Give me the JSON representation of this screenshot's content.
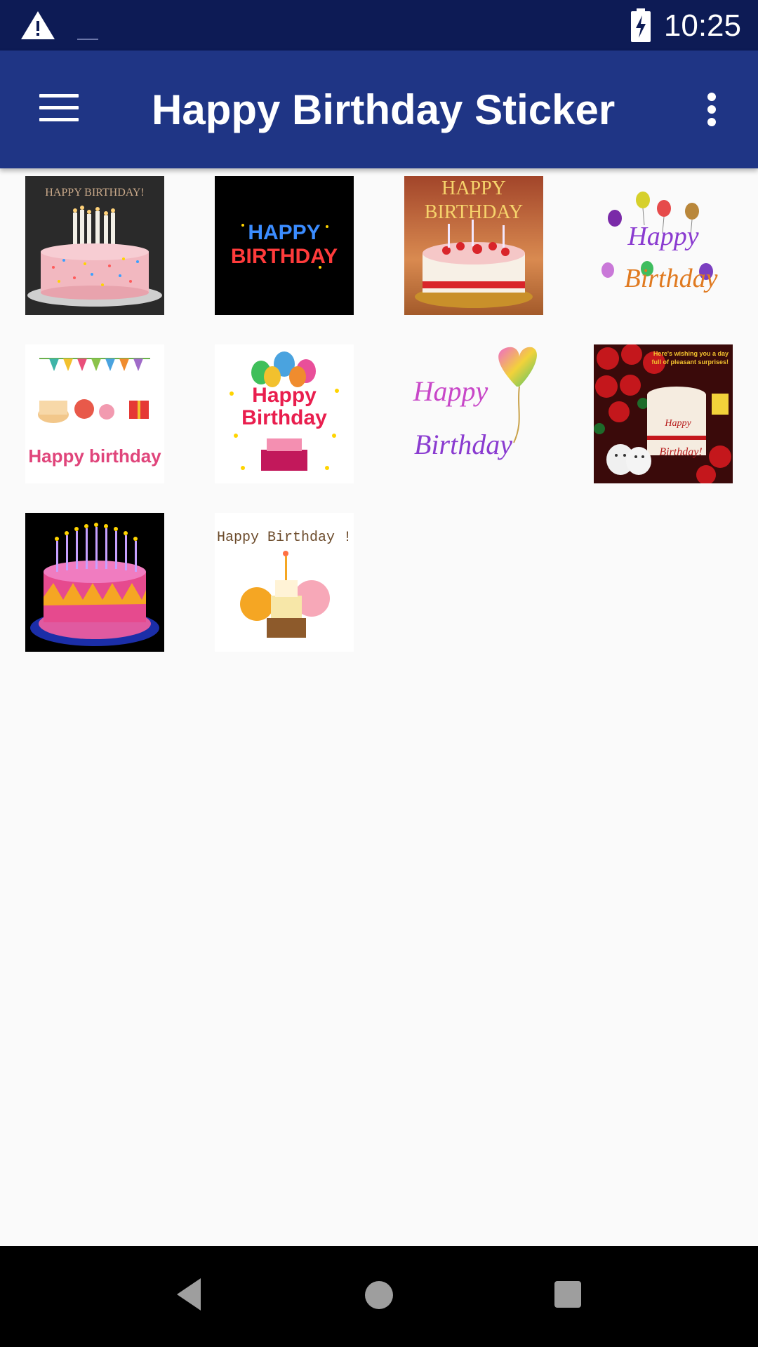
{
  "status_bar": {
    "time": "10:25",
    "icons": [
      "warning-icon",
      "battery-charging-icon"
    ]
  },
  "app_bar": {
    "title": "Happy Birthday Sticker",
    "icons": [
      "menu-icon",
      "more-vert-icon"
    ]
  },
  "stickers": [
    {
      "id": "sticker-1",
      "caption": "HAPPY BIRTHDAY!"
    },
    {
      "id": "sticker-2",
      "caption_line1": "HAPPY",
      "caption_line2": "BIRTHDAY"
    },
    {
      "id": "sticker-3",
      "caption_line1": "HAPPY",
      "caption_line2": "BIRTHDAY"
    },
    {
      "id": "sticker-4",
      "caption_line1": "Happy",
      "caption_line2": "Birthday"
    },
    {
      "id": "sticker-5",
      "caption": "Happy birthday"
    },
    {
      "id": "sticker-6",
      "caption_line1": "Happy",
      "caption_line2": "Birthday"
    },
    {
      "id": "sticker-7",
      "caption_line1": "Happy",
      "caption_line2": "Birthday"
    },
    {
      "id": "sticker-8",
      "caption_line1": "Here's wishing you a day",
      "caption_line2": "full of pleasant surprises!",
      "cake_line1": "Happy",
      "cake_line2": "Birthday!"
    },
    {
      "id": "sticker-9"
    },
    {
      "id": "sticker-10",
      "caption": "Happy Birthday !"
    }
  ],
  "nav_bar": {
    "icons": [
      "back-icon",
      "home-icon",
      "recents-icon"
    ]
  },
  "colors": {
    "status_bar": "#0d1b55",
    "app_bar": "#1f3585",
    "background": "#fafafa",
    "nav_bar": "#000000"
  }
}
